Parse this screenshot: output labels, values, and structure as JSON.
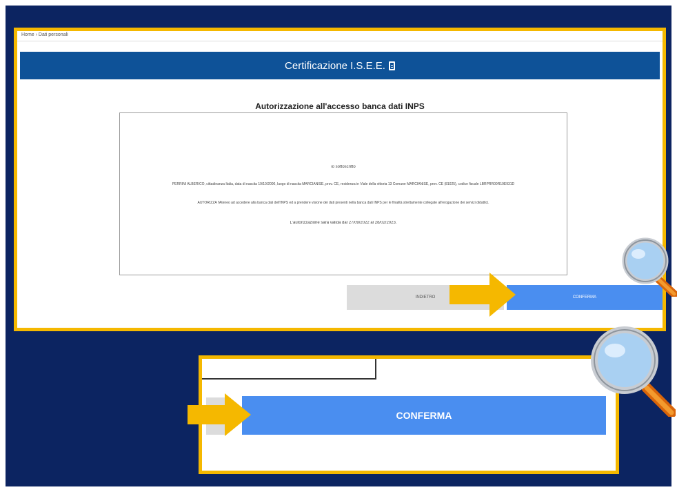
{
  "breadcrumb": "Home › Dati personali",
  "header": {
    "title": "Certificazione I.S.E.E."
  },
  "authorization": {
    "title": "Autorizzazione all'accesso banca dati INPS",
    "lines": [
      "io sottoscritto",
      "PERRINI ALBERICO, cittadinanza Italia, data di nascita 19/10/2000, luogo di nascita MARCIANISE, prov. CE, residenza in Viale della vittoria 13 Comune MARCIANISE, prov. CE (81025), codice fiscale LBRPRR00R19E931D",
      "AUTORIZZA l'Ateneo ad accedere alla banca dati dell'INPS ed a prendere visione dei dati presenti nella banca dati INPS per le finalità strettamente collegate all'erogazione dei servizi didattici.",
      "L'autorizzazione sarà valida dal 27/09/2022 al 28/02/2023."
    ]
  },
  "buttons": {
    "back": "INDIETRO",
    "confirm": "CONFERMA"
  },
  "zoom": {
    "confirm": "CONFERMA"
  },
  "colors": {
    "background": "#0c2461",
    "frame": "#f5b800",
    "titlebar": "#0e5298",
    "primary": "#4a8ef0",
    "secondary": "#dcdcdc"
  }
}
